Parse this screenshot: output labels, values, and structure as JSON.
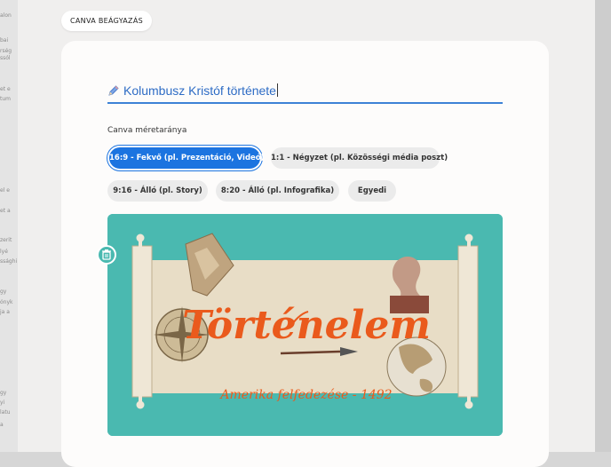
{
  "background": {
    "left_strip_fragments": [
      "alon",
      "bai",
      "rség",
      "ssól",
      "et e",
      "tum",
      "el e",
      "et a",
      "zerit",
      "lyé",
      "ssághi",
      "gy",
      "ónyk",
      "ja a",
      "gy",
      "yi",
      "latu",
      "a"
    ]
  },
  "modal": {
    "tag": "CANVA BEÁGYAZÁS",
    "title": "Kolumbusz Kristóf története",
    "ratio_label": "Canva méretaránya",
    "ratio_options": [
      "16:9 - Fekvő (pl. Prezentáció, Videó)",
      "1:1 - Négyzet (pl. Közösségi média poszt)",
      "9:16 - Álló (pl. Story)",
      "8:20 - Álló (pl. Infografika)",
      "Egyedi"
    ],
    "selected_ratio": "16:9 - Fekvő (pl. Prezentáció, Videó)"
  },
  "design": {
    "headline": "Történelem",
    "subtitle": "Amerika felfedezése - 1492"
  },
  "colors": {
    "accent": "#1c74e0",
    "teal": "#4ab9b0",
    "headline": "#ea5a1c",
    "parchment": "#e8ddc6"
  },
  "icons": {
    "title_icon": "pencil-icon",
    "delete_icon": "trash-icon"
  }
}
